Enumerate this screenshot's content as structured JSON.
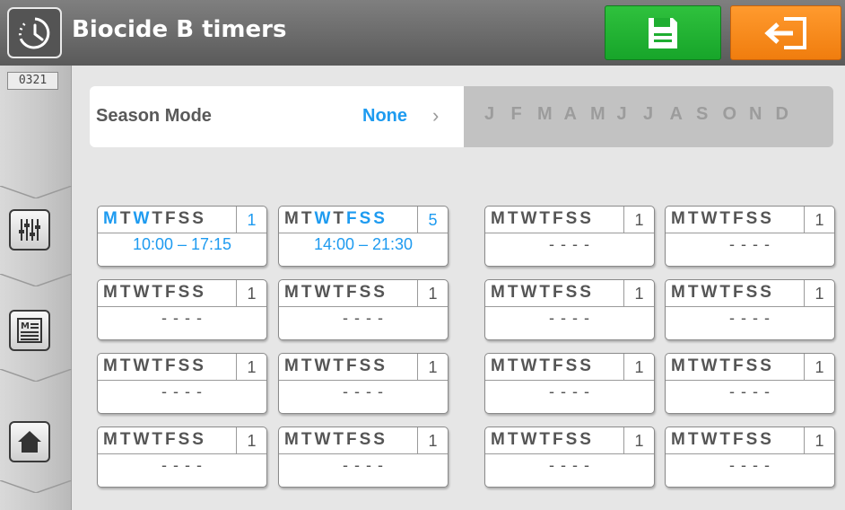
{
  "header": {
    "title": "Biocide B timers",
    "icon": "clock-icon",
    "save_icon": "save-icon",
    "exit_icon": "exit-icon",
    "colors": {
      "save": "#1fae31",
      "exit": "#f58a1f",
      "bar": "#6a6a6a"
    }
  },
  "sidebar": {
    "code": "0321",
    "buttons": [
      {
        "icon": "sliders-icon"
      },
      {
        "icon": "menu-list-icon"
      },
      {
        "icon": "home-icon"
      }
    ]
  },
  "season": {
    "label": "Season Mode",
    "value": "None",
    "chevron": "›",
    "months": [
      "J",
      "F",
      "M",
      "A",
      "M",
      "J",
      "J",
      "A",
      "S",
      "O",
      "N",
      "D"
    ]
  },
  "accent": "#1e9bf0",
  "timers": [
    {
      "days": [
        "M",
        "T",
        "W",
        "T",
        "F",
        "S",
        "S"
      ],
      "active": [
        true,
        false,
        true,
        false,
        false,
        false,
        false
      ],
      "number": "1",
      "time": "10:00 – 17:15",
      "on": true
    },
    {
      "days": [
        "M",
        "T",
        "W",
        "T",
        "F",
        "S",
        "S"
      ],
      "active": [
        false,
        false,
        true,
        false,
        true,
        true,
        true
      ],
      "number": "5",
      "time": "14:00 – 21:30",
      "on": true
    },
    {
      "days": [
        "M",
        "T",
        "W",
        "T",
        "F",
        "S",
        "S"
      ],
      "active": [
        false,
        false,
        false,
        false,
        false,
        false,
        false
      ],
      "number": "1",
      "time": "- - - -",
      "on": false
    },
    {
      "days": [
        "M",
        "T",
        "W",
        "T",
        "F",
        "S",
        "S"
      ],
      "active": [
        false,
        false,
        false,
        false,
        false,
        false,
        false
      ],
      "number": "1",
      "time": "- - - -",
      "on": false
    },
    {
      "days": [
        "M",
        "T",
        "W",
        "T",
        "F",
        "S",
        "S"
      ],
      "active": [
        false,
        false,
        false,
        false,
        false,
        false,
        false
      ],
      "number": "1",
      "time": "- - - -",
      "on": false
    },
    {
      "days": [
        "M",
        "T",
        "W",
        "T",
        "F",
        "S",
        "S"
      ],
      "active": [
        false,
        false,
        false,
        false,
        false,
        false,
        false
      ],
      "number": "1",
      "time": "- - - -",
      "on": false
    },
    {
      "days": [
        "M",
        "T",
        "W",
        "T",
        "F",
        "S",
        "S"
      ],
      "active": [
        false,
        false,
        false,
        false,
        false,
        false,
        false
      ],
      "number": "1",
      "time": "- - - -",
      "on": false
    },
    {
      "days": [
        "M",
        "T",
        "W",
        "T",
        "F",
        "S",
        "S"
      ],
      "active": [
        false,
        false,
        false,
        false,
        false,
        false,
        false
      ],
      "number": "1",
      "time": "- - - -",
      "on": false
    },
    {
      "days": [
        "M",
        "T",
        "W",
        "T",
        "F",
        "S",
        "S"
      ],
      "active": [
        false,
        false,
        false,
        false,
        false,
        false,
        false
      ],
      "number": "1",
      "time": "- - - -",
      "on": false
    },
    {
      "days": [
        "M",
        "T",
        "W",
        "T",
        "F",
        "S",
        "S"
      ],
      "active": [
        false,
        false,
        false,
        false,
        false,
        false,
        false
      ],
      "number": "1",
      "time": "- - - -",
      "on": false
    },
    {
      "days": [
        "M",
        "T",
        "W",
        "T",
        "F",
        "S",
        "S"
      ],
      "active": [
        false,
        false,
        false,
        false,
        false,
        false,
        false
      ],
      "number": "1",
      "time": "- - - -",
      "on": false
    },
    {
      "days": [
        "M",
        "T",
        "W",
        "T",
        "F",
        "S",
        "S"
      ],
      "active": [
        false,
        false,
        false,
        false,
        false,
        false,
        false
      ],
      "number": "1",
      "time": "- - - -",
      "on": false
    },
    {
      "days": [
        "M",
        "T",
        "W",
        "T",
        "F",
        "S",
        "S"
      ],
      "active": [
        false,
        false,
        false,
        false,
        false,
        false,
        false
      ],
      "number": "1",
      "time": "- - - -",
      "on": false
    },
    {
      "days": [
        "M",
        "T",
        "W",
        "T",
        "F",
        "S",
        "S"
      ],
      "active": [
        false,
        false,
        false,
        false,
        false,
        false,
        false
      ],
      "number": "1",
      "time": "- - - -",
      "on": false
    },
    {
      "days": [
        "M",
        "T",
        "W",
        "T",
        "F",
        "S",
        "S"
      ],
      "active": [
        false,
        false,
        false,
        false,
        false,
        false,
        false
      ],
      "number": "1",
      "time": "- - - -",
      "on": false
    },
    {
      "days": [
        "M",
        "T",
        "W",
        "T",
        "F",
        "S",
        "S"
      ],
      "active": [
        false,
        false,
        false,
        false,
        false,
        false,
        false
      ],
      "number": "1",
      "time": "- - - -",
      "on": false
    }
  ]
}
